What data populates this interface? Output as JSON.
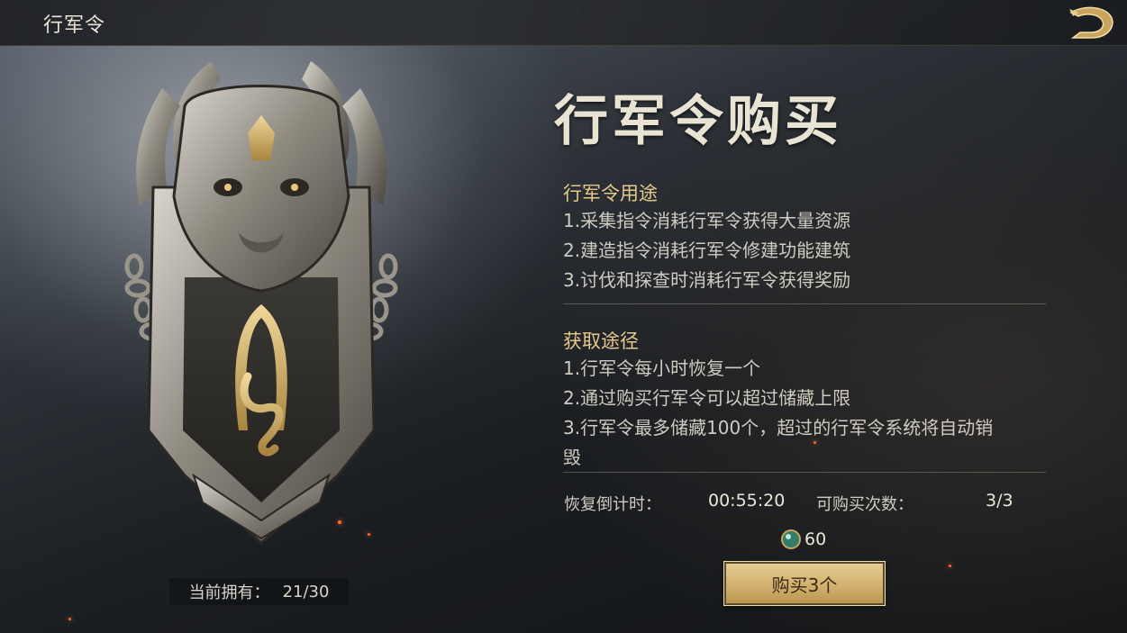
{
  "header": {
    "title": "行军令"
  },
  "main": {
    "heading": "行军令购买",
    "usage": {
      "title": "行军令用途",
      "items": [
        "1.采集指令消耗行军令获得大量资源",
        "2.建造指令消耗行军令修建功能建筑",
        "3.讨伐和探查时消耗行军令获得奖励"
      ]
    },
    "obtain": {
      "title": "获取途径",
      "items": [
        "1.行军令每小时恢复一个",
        "2.通过购买行军令可以超过储藏上限",
        "3.行军令最多储藏100个，超过的行军令系统将自动销",
        "毁"
      ]
    },
    "stats": {
      "recover_label": "恢复倒计时：",
      "recover_value": "00:55:20",
      "purchases_label": "可购买次数：",
      "purchases_value": "3/3"
    },
    "cost": {
      "icon": "jade-gem-icon",
      "value": "60"
    },
    "buy_button": "购买3个"
  },
  "owned": {
    "label": "当前拥有：",
    "value": "21/30"
  },
  "colors": {
    "accent_gold": "#e6c98b",
    "button_gold": "#d2b06e"
  }
}
